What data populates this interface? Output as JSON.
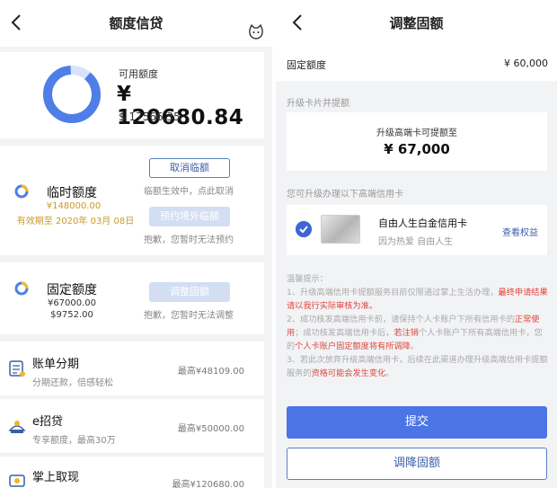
{
  "left": {
    "title": "额度信贷",
    "summary": {
      "available_label": "可用额度",
      "available_amount": "¥ 120680.84",
      "available_usd": "$ 17566.35",
      "usage_fraction": 0.0
    },
    "temp_limit": {
      "title": "临时额度",
      "amount_cny": "¥148000.00",
      "valid_until": "有效期至 2020年 03月 08日",
      "cancel_button": "取消临额",
      "cancel_hint": "临额生效中，点此取消",
      "reserve_button": "预约境外临额",
      "reserve_hint": "抱歉，您暂时无法预约"
    },
    "fixed_limit": {
      "title": "固定额度",
      "amount_cny": "¥67000.00",
      "amount_usd": "$9752.00",
      "adjust_button": "调整固额",
      "adjust_hint": "抱歉，您暂时无法调整"
    },
    "list": [
      {
        "title": "账单分期",
        "sub": "分期还款，倍感轻松",
        "max": "最高¥48109.00",
        "icon": "bill-installment-icon"
      },
      {
        "title": "e招贷",
        "sub": "专享额度，最高30万",
        "max": "最高¥50000.00",
        "icon": "e-loan-icon"
      },
      {
        "title": "掌上取现",
        "sub": "",
        "max": "最高¥120680.00",
        "icon": "cash-withdraw-icon"
      }
    ]
  },
  "right": {
    "title": "调整固额",
    "fixed_label": "固定额度",
    "fixed_value": "¥ 60,000",
    "section_upgrade": "升级卡片并提额",
    "upgrade_text": "升级高端卡可提额至",
    "upgrade_amount": "¥ 67,000",
    "section_cards": "您可升级办理以下高端信用卡",
    "card_name": "自由人生白金信用卡",
    "card_desc": "因为热爱 自由人生",
    "view_rights": "查看权益",
    "tips_title": "温馨提示：",
    "tip1_a": "1、升级高端信用卡提额服务目前仅限通过掌上生活办理，",
    "tip1_b": "最终申请结果请以我行实际审核为准。",
    "tip2_a": "2、成功核发高端信用卡前，请保持个人卡账户下所有信用卡的",
    "tip2_b": "正常使用",
    "tip2_c": "；成功核发高端信用卡后，",
    "tip2_d": "若注销",
    "tip2_e": "个人卡账户下所有高端信用卡，您的",
    "tip2_f": "个人卡账户固定额度将有所调降",
    "tip2_g": "。",
    "tip3_a": "3、若此次放弃升级高端信用卡，后续在此渠道办理升级高端信用卡提额服务的",
    "tip3_b": "资格可能会发生变化",
    "tip3_c": "。",
    "submit_button": "提交",
    "lower_button": "调降固额"
  },
  "colors": {
    "accent_blue": "#4b74e5",
    "donut_blue": "#4f7fe6",
    "gold": "#c89a2e",
    "warning_red": "#e0453b"
  }
}
